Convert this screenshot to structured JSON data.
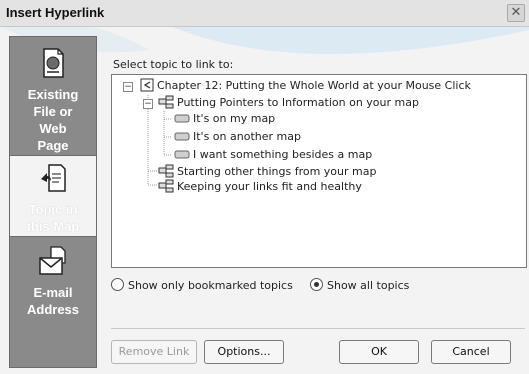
{
  "window": {
    "title": "Insert Hyperlink",
    "close_glyph": "✕"
  },
  "sidebar": {
    "items": [
      {
        "label_lines": [
          "Existing",
          "File or",
          "Web",
          "Page"
        ],
        "icon": "web-page-icon",
        "active": false
      },
      {
        "label_lines": [
          "Topic in",
          "this Map"
        ],
        "icon": "topic-link-icon",
        "active": true
      },
      {
        "label_lines": [
          "E-mail",
          "Address"
        ],
        "icon": "email-icon",
        "active": false
      }
    ]
  },
  "prompt": "Select topic to link to:",
  "tree": {
    "root": "Chapter 12: Putting the Whole World at your Mouse Click",
    "child": "Putting  Pointers to Information on your map",
    "grandchildren": [
      "It's on my map",
      "It's on another map",
      "I want something besides a map"
    ],
    "siblings": [
      "Starting other things from your map",
      "Keeping your links fit and healthy"
    ]
  },
  "radios": {
    "bookmarked": "Show only bookmarked topics",
    "all": "Show all topics",
    "selected": "all"
  },
  "buttons": {
    "remove": "Remove Link",
    "options": "Options...",
    "ok": "OK",
    "cancel": "Cancel"
  },
  "colors": {
    "sidebar": "#8a8a8a",
    "active": "#f3f3f3",
    "swoosh": "#cfe3ee"
  }
}
